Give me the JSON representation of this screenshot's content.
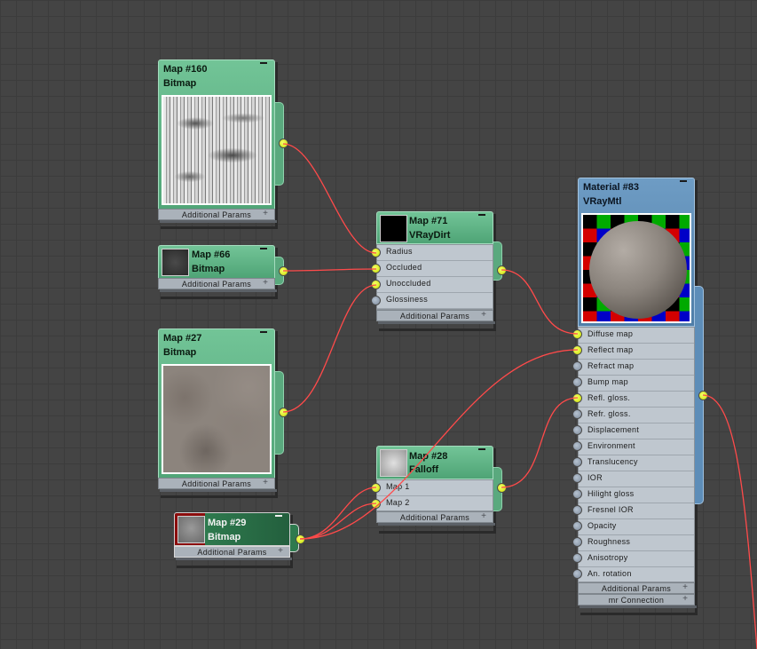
{
  "nodes": {
    "map160": {
      "title": "Map #160",
      "subtitle": "Bitmap",
      "footer": "Additional Params"
    },
    "map66": {
      "title": "Map #66",
      "subtitle": "Bitmap",
      "footer": "Additional Params"
    },
    "map27": {
      "title": "Map #27",
      "subtitle": "Bitmap",
      "footer": "Additional Params"
    },
    "map29": {
      "title": "Map #29",
      "subtitle": "Bitmap",
      "footer": "Additional Params"
    },
    "map71": {
      "title": "Map #71",
      "subtitle": "VRayDirt",
      "slots": [
        "Radius",
        "Occluded",
        "Unoccluded",
        "Glossiness"
      ],
      "footer": "Additional Params"
    },
    "map28": {
      "title": "Map #28",
      "subtitle": "Falloff",
      "slots": [
        "Map 1",
        "Map 2"
      ],
      "footer": "Additional Params"
    },
    "material83": {
      "title": "Material #83",
      "subtitle": "VRayMtl",
      "slots": [
        "Diffuse map",
        "Reflect map",
        "Refract map",
        "Bump map",
        "Refl. gloss.",
        "Refr. gloss.",
        "Displacement",
        "Environment",
        "Translucency",
        "IOR",
        "Hilight gloss",
        "Fresnel IOR",
        "Opacity",
        "Roughness",
        "Anisotropy",
        "An. rotation"
      ],
      "footer": "Additional Params",
      "footer2": "mr Connection"
    }
  },
  "colors": {
    "map_header": "#5fb386",
    "material_header": "#5a8bb6",
    "selected_header": "#2e7a4e",
    "wire": "#ff4a4a",
    "socket_connected": "#dcf000",
    "socket_empty": "#94a2b2",
    "background": "#444444"
  },
  "icons": [
    "minimize-icon",
    "expand-plus-icon",
    "socket-icon"
  ]
}
